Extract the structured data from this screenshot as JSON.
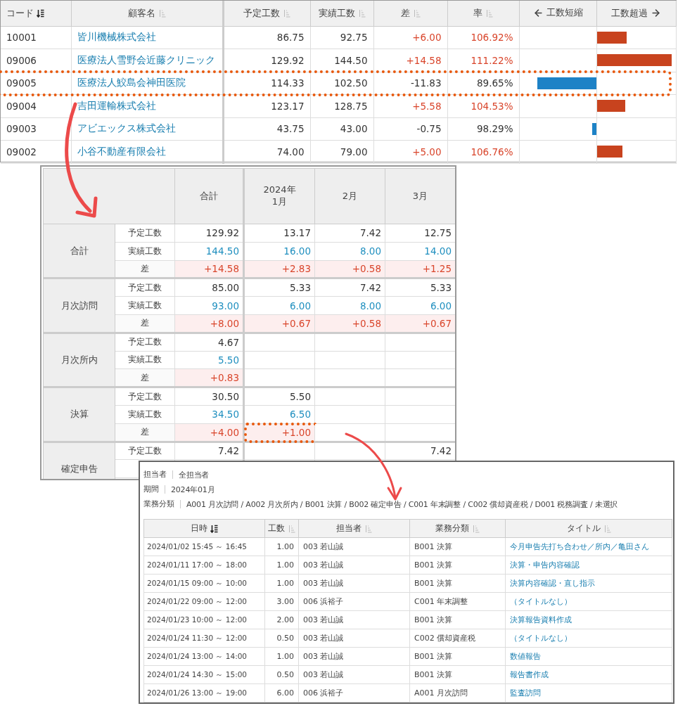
{
  "summary_table": {
    "columns": [
      {
        "label": "コード",
        "kind": "sort",
        "sorted": true
      },
      {
        "label": "顧客名",
        "kind": "sort",
        "sorted": false
      },
      {
        "label": "予定工数",
        "kind": "sort",
        "sorted": false
      },
      {
        "label": "実績工数",
        "kind": "sort",
        "sorted": false
      },
      {
        "label": "差",
        "kind": "sort",
        "sorted": false
      },
      {
        "label": "率",
        "kind": "sort",
        "sorted": false
      },
      {
        "label": "工数短縮",
        "kind": "arrow-left"
      },
      {
        "label": "工数超過",
        "kind": "arrow-right"
      }
    ],
    "rows": [
      {
        "code": "10001",
        "name": "皆川機械株式会社",
        "plan": "86.75",
        "actual": "92.75",
        "diff": "+6.00",
        "rate": "106.92%",
        "over": true,
        "highlighted": false,
        "bar": {
          "kind": "over",
          "level": 0.38
        }
      },
      {
        "code": "09006",
        "name": "医療法人雪野会近藤クリニック",
        "plan": "129.92",
        "actual": "144.50",
        "diff": "+14.58",
        "rate": "111.22%",
        "over": true,
        "highlighted": false,
        "bar": {
          "kind": "over",
          "level": 0.95
        }
      },
      {
        "code": "09005",
        "name": "医療法人鮫島会神田医院",
        "plan": "114.33",
        "actual": "102.50",
        "diff": "-11.83",
        "rate": "89.65%",
        "over": false,
        "highlighted": true,
        "bar": {
          "kind": "short",
          "level": 0.77
        }
      },
      {
        "code": "09004",
        "name": "吉田運輸株式会社",
        "plan": "123.17",
        "actual": "128.75",
        "diff": "+5.58",
        "rate": "104.53%",
        "over": true,
        "highlighted": false,
        "bar": {
          "kind": "over",
          "level": 0.36
        }
      },
      {
        "code": "09003",
        "name": "アビエックス株式会社",
        "plan": "43.75",
        "actual": "43.00",
        "diff": "-0.75",
        "rate": "98.29%",
        "over": false,
        "highlighted": false,
        "bar": {
          "kind": "short",
          "level": 0.05
        }
      },
      {
        "code": "09002",
        "name": "小谷不動産有限会社",
        "plan": "74.00",
        "actual": "79.00",
        "diff": "+5.00",
        "rate": "106.76%",
        "over": true,
        "highlighted": false,
        "bar": {
          "kind": "over",
          "level": 0.33
        }
      }
    ]
  },
  "detail_table": {
    "columns": [
      "合計",
      "2024年\n1月",
      "2月",
      "3月"
    ],
    "groups": [
      {
        "label": "合計",
        "rows": [
          {
            "kind": "plan",
            "label": "予定工数",
            "cells": [
              {
                "value": "129.92",
                "highlighted": false
              },
              {
                "value": "13.17",
                "highlighted": false
              },
              {
                "value": "7.42",
                "highlighted": false
              },
              {
                "value": "12.75",
                "highlighted": false
              }
            ]
          },
          {
            "kind": "actual",
            "label": "実績工数",
            "cells": [
              {
                "value": "144.50",
                "highlighted": false
              },
              {
                "value": "16.00",
                "highlighted": false
              },
              {
                "value": "8.00",
                "highlighted": false
              },
              {
                "value": "14.00",
                "highlighted": false
              }
            ]
          },
          {
            "kind": "diff",
            "label": "差",
            "cells": [
              {
                "value": "+14.58",
                "highlighted": false
              },
              {
                "value": "+2.83",
                "highlighted": false
              },
              {
                "value": "+0.58",
                "highlighted": false
              },
              {
                "value": "+1.25",
                "highlighted": false
              }
            ]
          }
        ]
      },
      {
        "label": "月次訪問",
        "rows": [
          {
            "kind": "plan",
            "label": "予定工数",
            "cells": [
              {
                "value": "85.00",
                "highlighted": false
              },
              {
                "value": "5.33",
                "highlighted": false
              },
              {
                "value": "7.42",
                "highlighted": false
              },
              {
                "value": "5.33",
                "highlighted": false
              }
            ]
          },
          {
            "kind": "actual",
            "label": "実績工数",
            "cells": [
              {
                "value": "93.00",
                "highlighted": false
              },
              {
                "value": "6.00",
                "highlighted": false
              },
              {
                "value": "8.00",
                "highlighted": false
              },
              {
                "value": "6.00",
                "highlighted": false
              }
            ]
          },
          {
            "kind": "diff",
            "label": "差",
            "cells": [
              {
                "value": "+8.00",
                "highlighted": false
              },
              {
                "value": "+0.67",
                "highlighted": false
              },
              {
                "value": "+0.58",
                "highlighted": false
              },
              {
                "value": "+0.67",
                "highlighted": false
              }
            ]
          }
        ]
      },
      {
        "label": "月次所内",
        "rows": [
          {
            "kind": "plan",
            "label": "予定工数",
            "cells": [
              {
                "value": "4.67",
                "highlighted": false
              },
              {
                "highlighted": false
              },
              {
                "highlighted": false
              },
              {
                "highlighted": false
              }
            ]
          },
          {
            "kind": "actual",
            "label": "実績工数",
            "cells": [
              {
                "value": "5.50",
                "highlighted": false
              },
              {
                "highlighted": false
              },
              {
                "highlighted": false
              },
              {
                "highlighted": false
              }
            ]
          },
          {
            "kind": "diff",
            "label": "差",
            "cells": [
              {
                "value": "+0.83",
                "highlighted": false
              },
              {
                "highlighted": false
              },
              {
                "highlighted": false
              },
              {
                "highlighted": false
              }
            ]
          }
        ]
      },
      {
        "label": "決算",
        "rows": [
          {
            "kind": "plan",
            "label": "予定工数",
            "cells": [
              {
                "value": "30.50",
                "highlighted": false
              },
              {
                "value": "5.50",
                "highlighted": false
              },
              {
                "highlighted": false
              },
              {
                "highlighted": false
              }
            ]
          },
          {
            "kind": "actual",
            "label": "実績工数",
            "cells": [
              {
                "value": "34.50",
                "highlighted": false
              },
              {
                "value": "6.50",
                "highlighted": false
              },
              {
                "highlighted": false
              },
              {
                "highlighted": false
              }
            ]
          },
          {
            "kind": "diff",
            "label": "差",
            "cells": [
              {
                "value": "+4.00",
                "highlighted": false
              },
              {
                "value": "+1.00",
                "highlighted": true
              },
              {
                "highlighted": false
              },
              {
                "highlighted": false
              }
            ]
          }
        ]
      },
      {
        "label": "確定申告",
        "rows": [
          {
            "kind": "plan",
            "label": "予定工数",
            "cells": [
              {
                "value": "7.42",
                "highlighted": false
              },
              {
                "highlighted": false
              },
              {
                "highlighted": false
              },
              {
                "value": "7.42",
                "highlighted": false
              }
            ]
          }
        ]
      }
    ]
  },
  "record_panel": {
    "filters": [
      {
        "label": "担当者",
        "value": "全担当者"
      },
      {
        "label": "期間",
        "value": "2024年01月"
      },
      {
        "label": "業務分類",
        "value": "A001 月次訪問 / A002 月次所内 / B001 決算 / B002 確定申告 / C001 年末調整 / C002 償却資産税 / D001 税務調査 / 未選択"
      }
    ],
    "columns": [
      {
        "label": "日時",
        "sorted": true
      },
      {
        "label": "工数",
        "sorted": false
      },
      {
        "label": "担当者",
        "sorted": false
      },
      {
        "label": "業務分類",
        "sorted": false
      },
      {
        "label": "タイトル",
        "sorted": false
      }
    ],
    "rows": [
      {
        "datetime": "2024/01/02 15:45 ～ 16:45",
        "hours": "1.00",
        "staff": "003 若山誠",
        "category": "B001 決算",
        "title": "今月申告先打ち合わせ／所内／亀田さん"
      },
      {
        "datetime": "2024/01/11 17:00 ～ 18:00",
        "hours": "1.00",
        "staff": "003 若山誠",
        "category": "B001 決算",
        "title": "決算・申告内容確認"
      },
      {
        "datetime": "2024/01/15 09:00 ～ 10:00",
        "hours": "1.00",
        "staff": "003 若山誠",
        "category": "B001 決算",
        "title": "決算内容確認・直し指示"
      },
      {
        "datetime": "2024/01/22 09:00 ～ 12:00",
        "hours": "3.00",
        "staff": "006 浜裕子",
        "category": "C001 年末調整",
        "title": "（タイトルなし）"
      },
      {
        "datetime": "2024/01/23 10:00 ～ 12:00",
        "hours": "2.00",
        "staff": "003 若山誠",
        "category": "B001 決算",
        "title": "決算報告資料作成"
      },
      {
        "datetime": "2024/01/24 11:30 ～ 12:00",
        "hours": "0.50",
        "staff": "003 若山誠",
        "category": "C002 償却資産税",
        "title": "（タイトルなし）"
      },
      {
        "datetime": "2024/01/24 13:00 ～ 14:00",
        "hours": "1.00",
        "staff": "003 若山誠",
        "category": "B001 決算",
        "title": "数値報告"
      },
      {
        "datetime": "2024/01/24 14:30 ～ 15:00",
        "hours": "0.50",
        "staff": "003 若山誠",
        "category": "B001 決算",
        "title": "報告書作成"
      },
      {
        "datetime": "2024/01/26 13:00 ～ 19:00",
        "hours": "6.00",
        "staff": "006 浜裕子",
        "category": "A001 月次訪問",
        "title": "監査訪問"
      }
    ]
  }
}
